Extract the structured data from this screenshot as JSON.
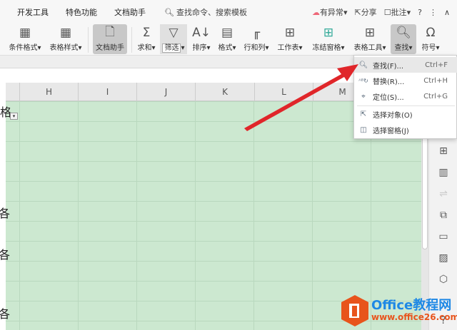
{
  "menubar": {
    "tabs": [
      "开发工具",
      "特色功能",
      "文档助手"
    ],
    "search": "查找命令、搜索模板",
    "status": "有异常",
    "share": "分享",
    "comment": "批注",
    "help": "?",
    "more": "⋮",
    "collapse": "∧"
  },
  "toolbar": {
    "buttons": [
      {
        "label": "条件格式",
        "icon": "conditional-format-icon"
      },
      {
        "label": "表格样式",
        "icon": "table-style-icon"
      },
      {
        "label": "文档助手",
        "icon": "doc-assistant-icon"
      },
      {
        "label": "求和",
        "icon": "sum-icon"
      },
      {
        "label": "筛选",
        "icon": "filter-icon"
      },
      {
        "label": "排序",
        "icon": "sort-icon"
      },
      {
        "label": "格式",
        "icon": "format-icon"
      },
      {
        "label": "行和列",
        "icon": "row-col-icon"
      },
      {
        "label": "工作表",
        "icon": "worksheet-icon"
      },
      {
        "label": "冻结窗格",
        "icon": "freeze-icon"
      },
      {
        "label": "表格工具",
        "icon": "table-tools-icon"
      },
      {
        "label": "查找",
        "icon": "search-icon"
      },
      {
        "label": "符号",
        "icon": "omega-icon"
      }
    ]
  },
  "columns": [
    "H",
    "I",
    "J",
    "K",
    "L",
    "M"
  ],
  "cells": {
    "fragment": "格",
    "fragment2": "各"
  },
  "dropdown": {
    "items": [
      {
        "label": "查找(F)...",
        "shortcut": "Ctrl+F"
      },
      {
        "label": "替换(R)...",
        "shortcut": "Ctrl+H"
      },
      {
        "label": "定位(S)...",
        "shortcut": "Ctrl+G"
      },
      {
        "label": "选择对象(O)",
        "shortcut": ""
      },
      {
        "label": "选择窗格(J)",
        "shortcut": ""
      }
    ]
  },
  "watermark": {
    "brand": "Office教程网",
    "url": "www.office26.com"
  },
  "colors": {
    "grid": "#cce8d0",
    "arrow": "#e0262a",
    "logo": "#e8541c",
    "brand_blue": "#1e88e5"
  }
}
